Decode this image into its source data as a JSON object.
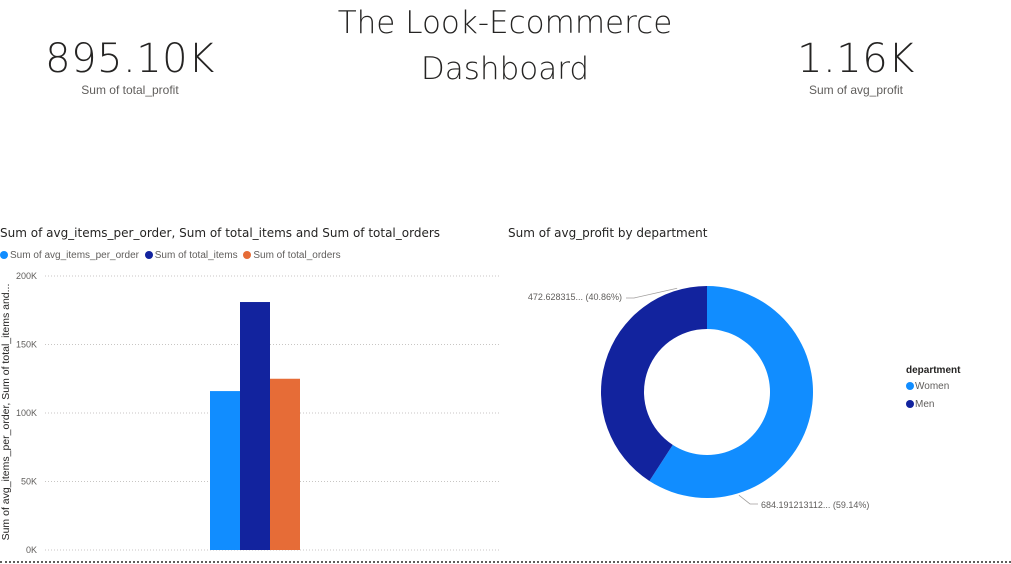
{
  "dashboard": {
    "title_line1": "The Look-Ecommerce",
    "title_line2": "Dashboard"
  },
  "kpis": [
    {
      "value": "895.10K",
      "label": "Sum of total_profit"
    },
    {
      "value": "1.16K",
      "label": "Sum of avg_profit"
    }
  ],
  "colors": {
    "avg_items_per_order": "#118dff",
    "total_items": "#12239e",
    "total_orders": "#e66c37",
    "women": "#118dff",
    "men": "#12239e"
  },
  "chart_data": [
    {
      "type": "bar",
      "title": "Sum of avg_items_per_order, Sum of total_items and Sum of total_orders",
      "ylabel": "Sum of avg_items_per_order, Sum of total_items and...",
      "xlabel": "",
      "categories": [
        ""
      ],
      "series": [
        {
          "name": "Sum of avg_items_per_order",
          "values": [
            116000
          ]
        },
        {
          "name": "Sum of total_items",
          "values": [
            181000
          ]
        },
        {
          "name": "Sum of total_orders",
          "values": [
            125000
          ]
        }
      ],
      "ylim": [
        0,
        200000
      ],
      "yticks": [
        0,
        50000,
        100000,
        150000,
        200000
      ],
      "ytick_labels": [
        "0K",
        "50K",
        "100K",
        "150K",
        "200K"
      ],
      "grid": true,
      "legend_position": "top-left"
    },
    {
      "type": "pie",
      "donut": true,
      "title": "Sum of avg_profit by department",
      "legend_title": "department",
      "legend_position": "right",
      "slices": [
        {
          "name": "Women",
          "value": 684.191213112,
          "percent": 59.14,
          "label": "684.191213112... (59.14%)"
        },
        {
          "name": "Men",
          "value": 472.628315,
          "percent": 40.86,
          "label": "472.628315... (40.86%)"
        }
      ]
    }
  ]
}
